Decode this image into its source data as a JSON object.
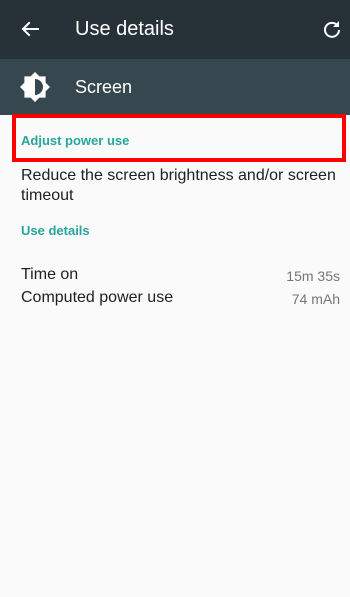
{
  "toolbar": {
    "back_icon": "arrow-back-icon",
    "title": "Use details",
    "refresh_icon": "refresh-icon"
  },
  "header": {
    "app_icon": "brightness-icon",
    "name": "Screen"
  },
  "adjust_section": {
    "title": "Adjust power use",
    "summary": "Reduce the screen brightness and/or screen timeout"
  },
  "details_section": {
    "title": "Use details",
    "rows": [
      {
        "label": "Time on",
        "value": "15m 35s"
      },
      {
        "label": "Computed power use",
        "value": "74 mAh"
      }
    ]
  },
  "colors": {
    "toolbar_bg": "#263238",
    "header_bg": "#37474f",
    "accent": "#26a69a",
    "highlight": "#ff0000"
  }
}
